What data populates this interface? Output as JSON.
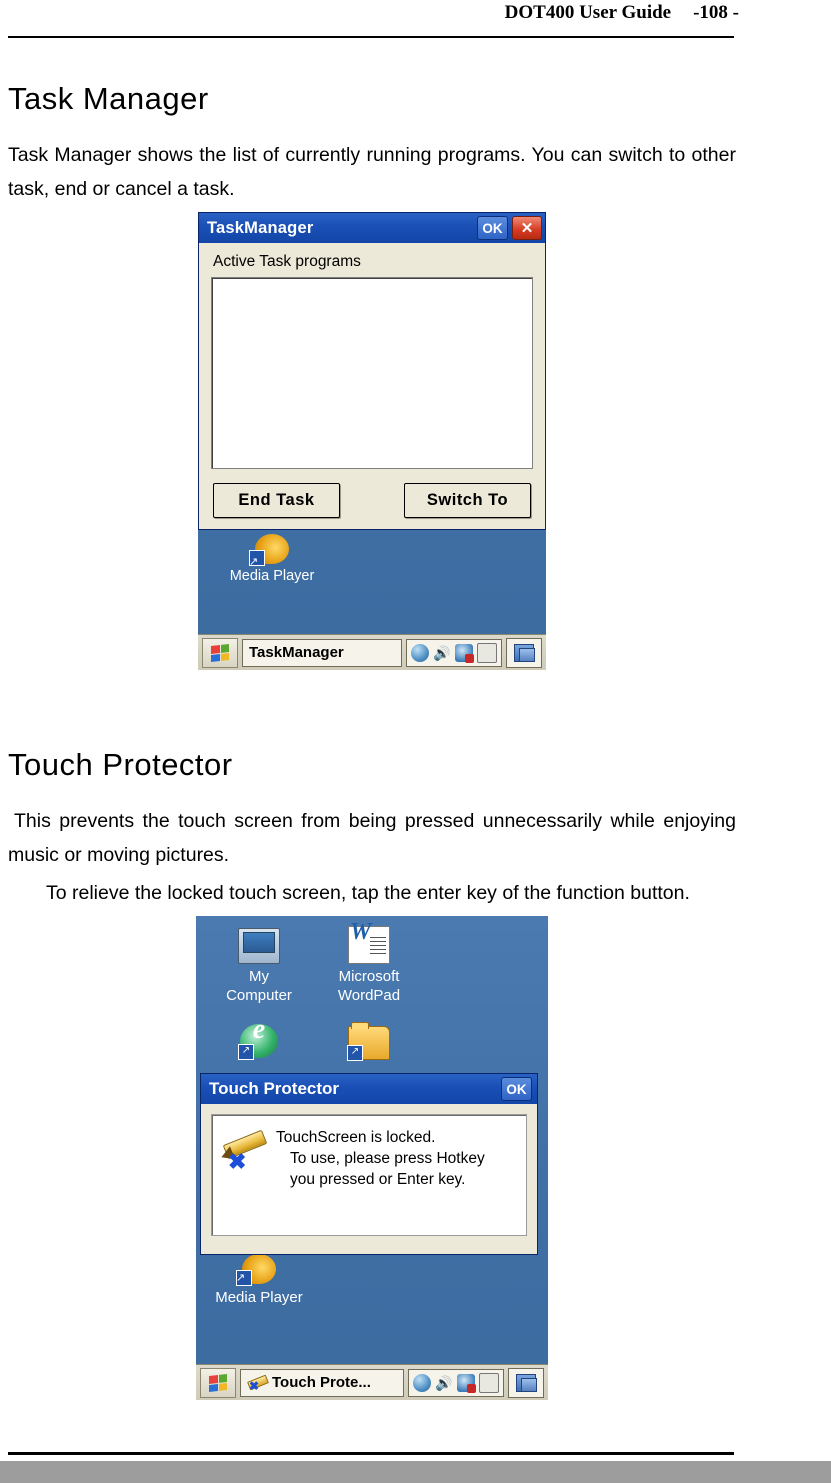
{
  "header": {
    "title": "DOT400 User Guide",
    "page_number": "-108 -"
  },
  "sections": [
    {
      "heading": "Task Manager",
      "paragraphs": [
        "Task Manager shows the list of currently running programs. You can switch to other task, end or cancel a task."
      ]
    },
    {
      "heading": "Touch Protector",
      "paragraphs": [
        "This prevents the touch screen from being pressed unnecessarily while enjoying music or moving pictures.",
        "To relieve the locked touch screen, tap the enter key of the function button."
      ]
    }
  ],
  "task_manager_screenshot": {
    "dialog": {
      "title": "TaskManager",
      "ok_label": "OK",
      "close_label": "✕",
      "group_label": "Active Task programs",
      "listbox_items": [],
      "end_task_label": "End Task",
      "switch_to_label": "Switch To"
    },
    "desktop_icons": [
      {
        "label": "Media Player",
        "icon": "media-player-icon"
      }
    ],
    "taskbar": {
      "start_icon": "windows-start-icon",
      "task_button": "TaskManager",
      "tray_icons": [
        "globe-icon",
        "speaker-icon",
        "ime-icon",
        "keyboard-icon"
      ],
      "show_desktop_icon": "show-desktop-icon"
    }
  },
  "touch_protector_screenshot": {
    "desktop_icons": [
      {
        "label_line1": "My",
        "label_line2": "Computer",
        "icon": "my-computer-icon"
      },
      {
        "label_line1": "Microsoft",
        "label_line2": "WordPad",
        "icon": "wordpad-icon"
      },
      {
        "label_line1": "",
        "label_line2": "",
        "icon": "internet-explorer-icon"
      },
      {
        "label_line1": "",
        "label_line2": "",
        "icon": "folder-icon"
      },
      {
        "label_line1": "Media Player",
        "label_line2": "",
        "icon": "media-player-icon"
      }
    ],
    "dialog": {
      "title": "Touch Protector",
      "ok_label": "OK",
      "icon": "locked-pencil-icon",
      "message_line1": "TouchScreen is locked.",
      "message_line2": "To use, please press Hotkey",
      "message_line3": "you pressed or Enter key."
    },
    "taskbar": {
      "start_icon": "windows-start-icon",
      "task_button": "Touch Prote...",
      "tray_icons": [
        "globe-icon",
        "speaker-icon",
        "ime-icon",
        "keyboard-icon"
      ],
      "show_desktop_icon": "show-desktop-icon"
    }
  }
}
